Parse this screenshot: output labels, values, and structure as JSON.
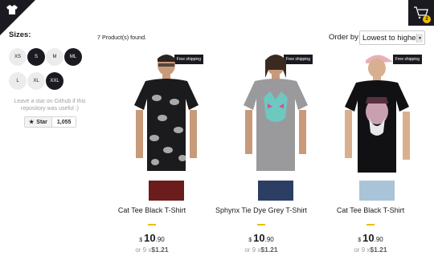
{
  "logo_icon": "shirt-icon",
  "filters": {
    "title": "Sizes:",
    "sizes": [
      {
        "label": "XS",
        "active": false
      },
      {
        "label": "S",
        "active": true
      },
      {
        "label": "M",
        "active": false
      },
      {
        "label": "ML",
        "active": true
      },
      {
        "label": "L",
        "active": false
      },
      {
        "label": "XL",
        "active": false
      },
      {
        "label": "XXL",
        "active": true
      }
    ]
  },
  "github": {
    "note": "Leave a star on Github if this repository was useful :)",
    "star_label": "Star",
    "star_count": "1,055"
  },
  "shelf": {
    "found_text": "7 Product(s) found.",
    "order_label": "Order by",
    "order_selected": "Lowest to highest"
  },
  "cart": {
    "count": "2",
    "icon": "cart-icon"
  },
  "products": [
    {
      "badge": "Free shipping",
      "title": "Cat Tee Black T-Shirt",
      "currency": "$",
      "price_int": "10",
      "price_dec": ".90",
      "installment_prefix": "or 9 x",
      "installment_value": "$1.21",
      "shirt_color": "#1b1a1d"
    },
    {
      "badge": "Free shipping",
      "title": "Sphynx Tie Dye Grey T-Shirt",
      "currency": "$",
      "price_int": "10",
      "price_dec": ".90",
      "installment_prefix": "or 9 x",
      "installment_value": "$1.21",
      "shirt_color": "#9a9a9c"
    },
    {
      "badge": "Free shipping",
      "title": "Cat Tee Black T-Shirt",
      "currency": "$",
      "price_int": "10",
      "price_dec": ".90",
      "installment_prefix": "or 9 x",
      "installment_value": "$1.21",
      "shirt_color": "#111113"
    }
  ],
  "colors": {
    "accent": "#eabf00",
    "dark": "#1b1a20"
  }
}
